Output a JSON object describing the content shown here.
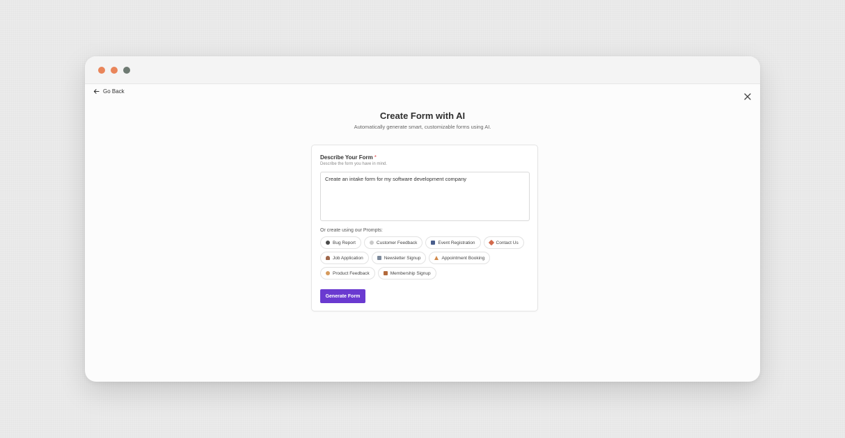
{
  "colors": {
    "accent": "#6a3ad0",
    "window_dot_1": "#e9855a",
    "window_dot_2": "#e9855a",
    "window_dot_3": "#6e7a72",
    "required": "#e04b4b"
  },
  "nav": {
    "back_label": "Go Back",
    "back_icon": "arrow-left-icon",
    "close_icon": "close-icon"
  },
  "header": {
    "title": "Create Form with AI",
    "subtitle": "Automatically generate smart, customizable forms using AI."
  },
  "form": {
    "label": "Describe Your Form",
    "required_marker": "*",
    "help": "Describe the form you have in mind.",
    "value": "Create an intake form for my software development company"
  },
  "prompts": {
    "label": "Or create using our Prompts:",
    "rows": [
      [
        {
          "label": "Bug Report",
          "icon": "bug-icon"
        },
        {
          "label": "Customer Feedback",
          "icon": "feedback-icon"
        },
        {
          "label": "Event Registration",
          "icon": "calendar-icon"
        },
        {
          "label": "Contact Us",
          "icon": "phone-icon"
        }
      ],
      [
        {
          "label": "Job Application",
          "icon": "person-icon"
        },
        {
          "label": "Newsletter Signup",
          "icon": "newspaper-icon"
        },
        {
          "label": "Appointment Booking",
          "icon": "cone-icon"
        }
      ],
      [
        {
          "label": "Product Feedback",
          "icon": "product-icon"
        },
        {
          "label": "Membership Signup",
          "icon": "membership-icon"
        }
      ]
    ]
  },
  "actions": {
    "generate_label": "Generate Form"
  }
}
